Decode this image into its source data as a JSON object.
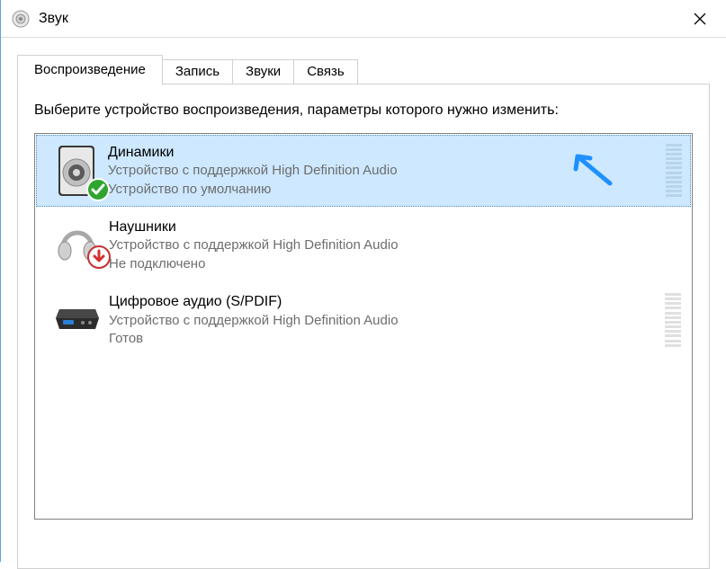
{
  "window": {
    "title": "Звук"
  },
  "tabs": [
    {
      "label": "Воспроизведение",
      "active": true
    },
    {
      "label": "Запись",
      "active": false
    },
    {
      "label": "Звуки",
      "active": false
    },
    {
      "label": "Связь",
      "active": false
    }
  ],
  "instruction": "Выберите устройство воспроизведения, параметры которого нужно изменить:",
  "devices": [
    {
      "name": "Динамики",
      "desc": "Устройство с поддержкой High Definition Audio",
      "status": "Устройство по умолчанию",
      "selected": true,
      "badge": "check",
      "meter": "on",
      "icon": "speaker"
    },
    {
      "name": "Наушники",
      "desc": "Устройство с поддержкой High Definition Audio",
      "status": "Не подключено",
      "selected": false,
      "badge": "down",
      "meter": "none",
      "icon": "headphones"
    },
    {
      "name": "Цифровое аудио (S/PDIF)",
      "desc": "Устройство с поддержкой High Definition Audio",
      "status": "Готов",
      "selected": false,
      "badge": "none",
      "meter": "muted",
      "icon": "spdif"
    }
  ],
  "colors": {
    "selection": "#cde8ff",
    "muted_text": "#6d6d6d"
  }
}
